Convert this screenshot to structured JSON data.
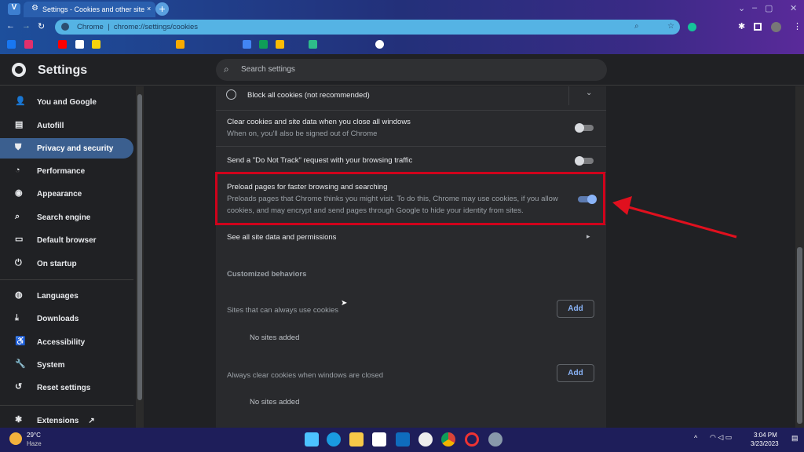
{
  "browser": {
    "tab_title": "Settings - Cookies and other site",
    "url_prefix": "Chrome",
    "url": "chrome://settings/cookies",
    "new_tab": "+",
    "tab_close": "×"
  },
  "header": {
    "title": "Settings",
    "search_placeholder": "Search settings"
  },
  "sidebar": {
    "items": [
      {
        "label": "You and Google",
        "icon": "person-icon"
      },
      {
        "label": "Autofill",
        "icon": "autofill-icon"
      },
      {
        "label": "Privacy and security",
        "icon": "shield-icon"
      },
      {
        "label": "Performance",
        "icon": "speedometer-icon"
      },
      {
        "label": "Appearance",
        "icon": "palette-icon"
      },
      {
        "label": "Search engine",
        "icon": "search-icon"
      },
      {
        "label": "Default browser",
        "icon": "browser-icon"
      },
      {
        "label": "On startup",
        "icon": "power-icon"
      },
      {
        "label": "Languages",
        "icon": "globe-icon"
      },
      {
        "label": "Downloads",
        "icon": "download-icon"
      },
      {
        "label": "Accessibility",
        "icon": "accessibility-icon"
      },
      {
        "label": "System",
        "icon": "wrench-icon"
      },
      {
        "label": "Reset settings",
        "icon": "reset-icon"
      }
    ],
    "extensions": "Extensions"
  },
  "main": {
    "block_all": "Block all cookies (not recommended)",
    "clear_on_close": {
      "title": "Clear cookies and site data when you close all windows",
      "sub": "When on, you'll also be signed out of Chrome",
      "enabled": false
    },
    "dnt": {
      "title": "Send a \"Do Not Track\" request with your browsing traffic",
      "enabled": false
    },
    "preload": {
      "title": "Preload pages for faster browsing and searching",
      "sub1": "Preloads pages that Chrome thinks you might visit. To do this, Chrome may use cookies, if you allow",
      "sub2": "cookies, and may encrypt and send pages through Google to hide your identity from sites.",
      "enabled": true
    },
    "see_all": "See all site data and permissions",
    "customized": "Customized behaviors",
    "always_use": {
      "label": "Sites that can always use cookies",
      "add": "Add",
      "empty": "No sites added"
    },
    "always_clear": {
      "label": "Always clear cookies when windows are closed",
      "add": "Add",
      "empty": "No sites added"
    }
  },
  "taskbar": {
    "temp": "29°C",
    "weather": "Haze",
    "time": "3:04 PM",
    "date": "3/23/2023"
  },
  "colors": {
    "accent": "#8ab4f8",
    "highlight": "#d0021b"
  }
}
